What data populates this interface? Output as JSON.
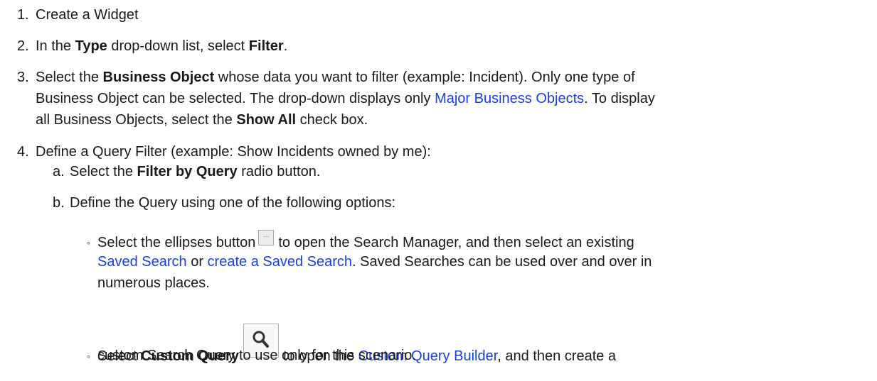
{
  "steps": {
    "s1": {
      "num": "1.",
      "text": "Create a Widget"
    },
    "s2": {
      "num": "2.",
      "t1": "In the ",
      "b1": "Type",
      "t2": " drop-down list, select ",
      "b2": "Filter",
      "t3": "."
    },
    "s3": {
      "num": "3.",
      "t1": "Select the ",
      "b1": "Business Object",
      "t2": " whose data you want to filter (example: Incident). Only one type of",
      "l2a": "Business Object can be selected. The drop-down displays only ",
      "link1": "Major Business Objects",
      "l2b": ". To display",
      "l3a": "all Business Objects, select the ",
      "b2": "Show All",
      "l3b": " check box."
    },
    "s4": {
      "num": "4.",
      "text": "Define a Query Filter (example: Show Incidents owned by me):",
      "a": {
        "num": "a.",
        "t1": "Select the ",
        "b1": "Filter by Query",
        "t2": " radio button."
      },
      "b": {
        "num": "b.",
        "text": "Define the Query using one of the following options:"
      },
      "opt1": {
        "bullet": "◦",
        "t1": "Select the ellipses button",
        "btn_label": "...",
        "t2": "to open the Search Manager, and then select an existing",
        "link1": "Saved Search",
        "t3": " or ",
        "link2": "create a Saved Search",
        "t4": ". Saved Searches can be used over and over in",
        "t5": "numerous places."
      },
      "opt2": {
        "bullet": "◦",
        "t1": "Select ",
        "b1": "Custom Query",
        "t2": "to open the ",
        "link1": "Custom Query Builder",
        "t3": ", and then create a",
        "t4": "custom Search Query to use only for this scenario."
      }
    }
  },
  "colors": {
    "link": "#1a40d9",
    "text": "#1a1a1a"
  },
  "icons": {
    "ellipsis_button": "ellipsis-icon",
    "custom_query_button": "search-icon"
  }
}
